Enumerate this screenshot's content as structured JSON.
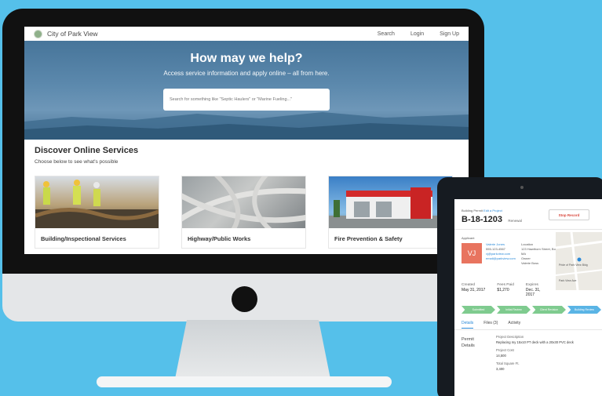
{
  "desktop": {
    "header": {
      "site_name": "City of Park View",
      "nav": [
        "Search",
        "Login",
        "Sign Up"
      ]
    },
    "hero": {
      "title": "How may we help?",
      "subtitle": "Access service information and apply online – all from here.",
      "search_placeholder": "Search for something like \"Septic Haulers\" or \"Marine Fueling...\""
    },
    "discover": {
      "title": "Discover Online Services",
      "subtitle": "Choose below to see what's possible",
      "cards": [
        {
          "title": "Building/Inspectional Services"
        },
        {
          "title": "Highway/Public Works"
        },
        {
          "title": "Fire Prevention & Safety"
        }
      ]
    }
  },
  "tablet": {
    "breadcrumb_prefix": "Building Permit",
    "breadcrumb_link": "Edit a Project",
    "record_id": "B-18-1203",
    "record_status": "Renewal",
    "stop_button": "Stop Record",
    "applicant_label": "Applicant",
    "avatar_initials": "VJ",
    "applicant_lines": [
      "Valerie Jones",
      "555-123-4567",
      "vj@parkview.com",
      "email@parkview.com"
    ],
    "location_lines": [
      "Location",
      "123 Hawthorn Street, Boston",
      "MA",
      "Owner",
      "Valerie Boss"
    ],
    "stats": [
      {
        "label": "Created",
        "value": "May 31, 2017"
      },
      {
        "label": "Fees Paid",
        "value": "$1,270"
      },
      {
        "label": "Expires",
        "value": "Dec. 31, 2017"
      }
    ],
    "steps": [
      "Submitted",
      "Initial Review",
      "Client Revision",
      "Building Review"
    ],
    "tabs": [
      "Details",
      "Files (3)",
      "Activity"
    ],
    "permit_label_lines": [
      "Permit",
      "Details"
    ],
    "details": [
      {
        "label": "Project Description",
        "value": "Replacing my 15x10 PT deck with a 20x30 PVC deck"
      },
      {
        "label": "Project Cost",
        "value": "14,500"
      },
      {
        "label": "Total Square Ft.",
        "value": "3,400"
      }
    ],
    "map_labels": [
      "Pride of Park View Bldg",
      "Park View Ave"
    ]
  },
  "colors": {
    "background": "#55c0ea",
    "avatar": "#e8745f",
    "step_done": "#7fcb8f",
    "step_current": "#5ab4e5",
    "link": "#2b8ad8",
    "stop_text": "#d9463b"
  },
  "icons": [
    "city-seal-logo-icon",
    "map-pin-icon",
    "power-button-icon",
    "camera-dot-icon"
  ]
}
